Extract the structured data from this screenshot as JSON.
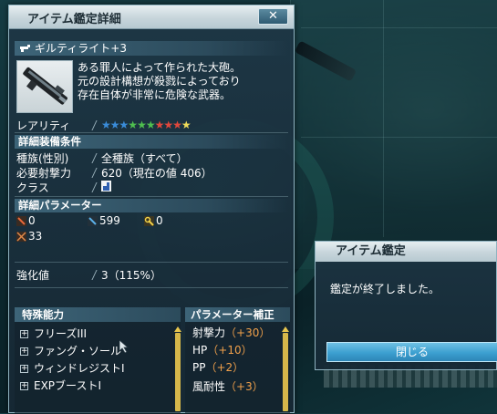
{
  "window": {
    "title": "アイテム鑑定詳細",
    "close_label": "✕"
  },
  "item": {
    "name": "ギルティライト+3",
    "description": [
      "ある罪人によって作られた大砲。",
      "元の設計構想が殺戮によっており",
      "存在自体が非常に危険な武器。"
    ],
    "rarity_label": "レアリティ",
    "rarity_stars": "★★★★★★★★★★",
    "rarity_count": 10
  },
  "equip_conditions": {
    "header": "詳細装備条件",
    "rows": [
      {
        "label": "種族(性別)",
        "value": "全種族（すべて）"
      },
      {
        "label": "必要射撃力",
        "value": "620（現在の値 406）"
      },
      {
        "label": "クラス",
        "value": ""
      }
    ]
  },
  "parameters": {
    "header": "詳細パラメーター",
    "values": [
      {
        "icon": "sword-attack-icon",
        "value": "0"
      },
      {
        "icon": "ranged-attack-icon",
        "value": "599"
      },
      {
        "icon": "tech-attack-icon",
        "value": "0"
      },
      {
        "icon": "accuracy-icon",
        "value": "33"
      }
    ]
  },
  "enhancement": {
    "label": "強化値",
    "value": "3（115%）"
  },
  "special_abilities": {
    "header": "特殊能力",
    "items": [
      "フリーズIII",
      "ファング・ソール",
      "ウィンドレジストI",
      "EXPブーストI"
    ]
  },
  "parameter_correction": {
    "header": "パラメーター補正",
    "items": [
      {
        "label": "射撃力",
        "bonus": "（+30）"
      },
      {
        "label": "HP",
        "bonus": "（+10）"
      },
      {
        "label": "PP",
        "bonus": "（+2）"
      },
      {
        "label": "風耐性",
        "bonus": "（+3）"
      }
    ]
  },
  "popup": {
    "title": "アイテム鑑定",
    "message": "鑑定が終了しました。",
    "close_label": "閉じる"
  },
  "colors": {
    "accent_blue": "#3c9fd0",
    "bonus_orange": "#f0a04b",
    "scrollbar_gold": "#d6b74a"
  }
}
